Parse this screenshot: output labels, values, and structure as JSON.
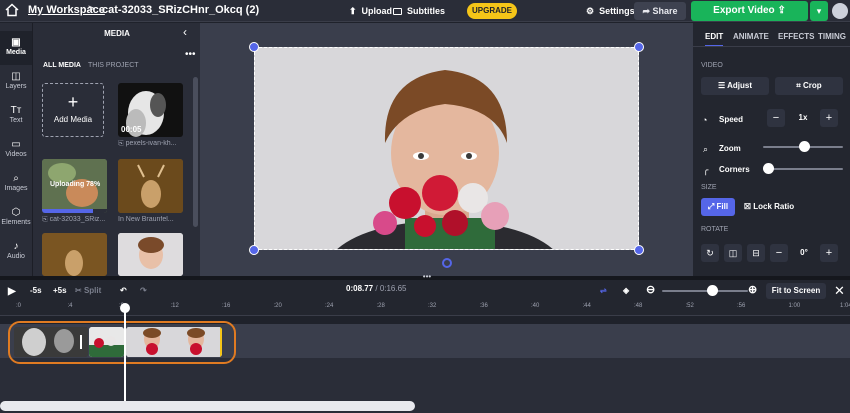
{
  "topbar": {
    "workspace_label": "My Workspace",
    "separator": ">",
    "project_title": "cat-32033_SRizCHnr_Okcq (2)",
    "upload_label": "Upload",
    "subtitles_label": "Subtitles",
    "upgrade_label": "UPGRADE",
    "settings_label": "Settings",
    "share_label": "Share",
    "export_label": "Export Video",
    "brand_color": "#19b45a",
    "upgrade_color": "#f5c518"
  },
  "rail": {
    "items": [
      {
        "label": "Media",
        "icon": "media-icon"
      },
      {
        "label": "Layers",
        "icon": "layers-icon"
      },
      {
        "label": "Text",
        "icon": "text-icon"
      },
      {
        "label": "Videos",
        "icon": "videos-icon"
      },
      {
        "label": "Images",
        "icon": "images-icon"
      },
      {
        "label": "Elements",
        "icon": "elements-icon"
      },
      {
        "label": "Audio",
        "icon": "audio-icon"
      }
    ]
  },
  "media": {
    "title": "MEDIA",
    "tab_all": "ALL MEDIA",
    "tab_project": "THIS PROJECT",
    "add_label": "Add Media",
    "items": [
      {
        "label": "pexels-ivan-kh...",
        "duration": "00:05"
      },
      {
        "label": "cat-32033_SRiz...",
        "status": "Uploading  78%",
        "progress": 0.78
      },
      {
        "label": "In New Braunfel...",
        "status": ""
      }
    ]
  },
  "props": {
    "tabs": [
      "EDIT",
      "ANIMATE",
      "EFFECTS",
      "TIMING"
    ],
    "video_section": "VIDEO",
    "adjust_label": "Adjust",
    "crop_label": "Crop",
    "speed_label": "Speed",
    "speed_value": "1x",
    "zoom_label": "Zoom",
    "zoom_level": 0.52,
    "corners_label": "Corners",
    "corners_level": 0.0,
    "size_section": "SIZE",
    "fill_label": "Fill",
    "lock_ratio_label": "Lock Ratio",
    "rotate_section": "ROTATE",
    "rotate_value": "0°",
    "accent": "#5566e8"
  },
  "timeline": {
    "skip_back_label": "-5s",
    "skip_fwd_label": "+5s",
    "split_label": "Split",
    "current_time": "0:08.77",
    "total_time": "0:16.65",
    "fit_label": "Fit to Screen",
    "ticks": [
      ":0",
      ":4",
      ":8",
      ":12",
      ":16",
      ":20",
      ":24",
      ":28",
      ":32",
      ":36",
      ":40",
      ":44",
      ":48",
      ":52",
      ":56",
      "1:00",
      "1:04"
    ],
    "zoom_level": 0.6
  }
}
